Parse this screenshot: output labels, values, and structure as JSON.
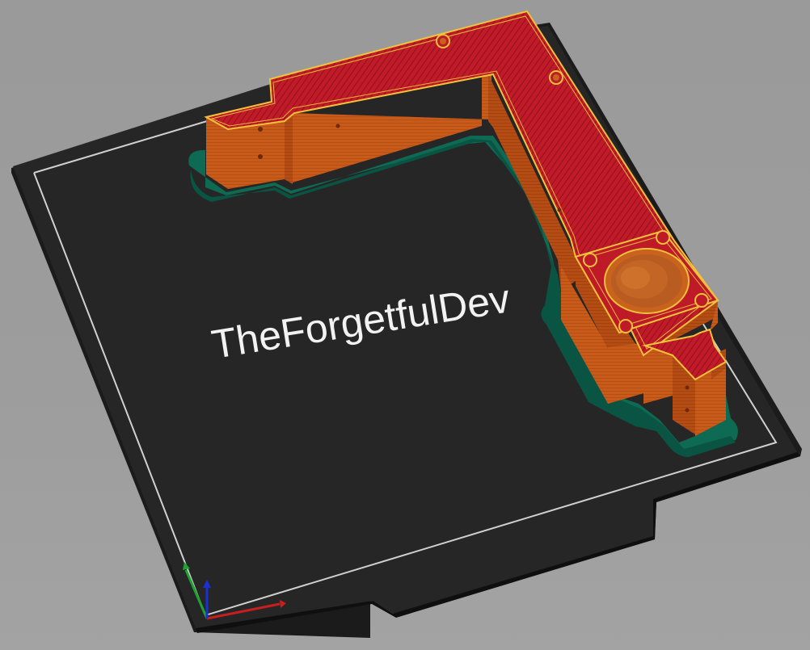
{
  "viewport": {
    "bed_label": "TheForgetfulDev"
  },
  "colors": {
    "background": "#9d9d9d",
    "bed": "#262626",
    "bed_edge": "#111111",
    "bed_outline": "#d8d8d8",
    "skirt": "#0f6b55",
    "perimeter": "#c5591c",
    "infill": "#bf1a28",
    "infill_lines": "#8e0f1a",
    "outline_highlight": "#f2c23a",
    "axis_x": "#c81e1e",
    "axis_y": "#1fa32e",
    "axis_z": "#1a2fd6"
  },
  "icons": [
    "axis-gizmo-icon"
  ]
}
